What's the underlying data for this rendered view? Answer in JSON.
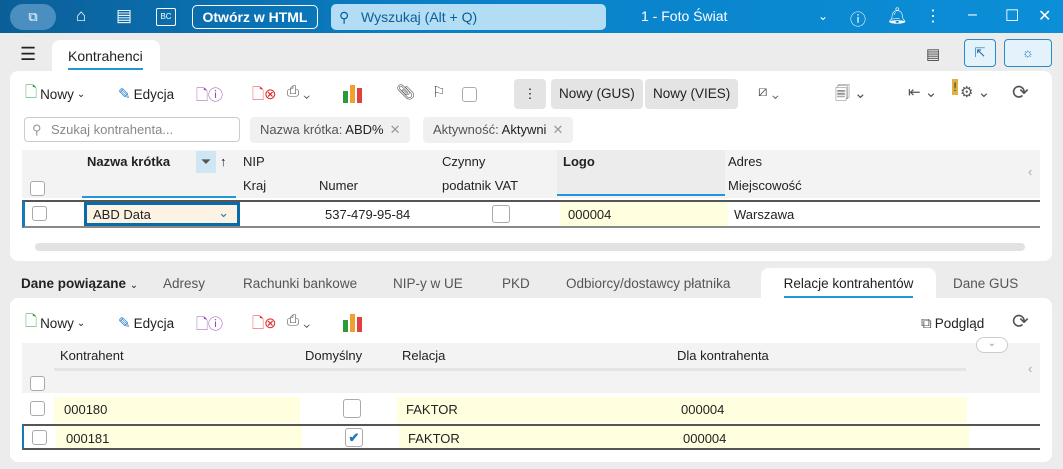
{
  "titlebar": {
    "open_html": "Otwórz w HTML",
    "search_placeholder": "Wyszukaj (Alt + Q)",
    "company": "1 - Foto Świat",
    "bc": "BC"
  },
  "tab": "Kontrahenci",
  "toolbar": {
    "new": "Nowy",
    "edit": "Edycja",
    "new_gus": "Nowy (GUS)",
    "new_vies": "Nowy (VIES)"
  },
  "filters": {
    "search_placeholder": "Szukaj kontrahenta...",
    "chip1_label": "Nazwa krótka:",
    "chip1_value": "ABD%",
    "chip2_label": "Aktywność:",
    "chip2_value": "Aktywni"
  },
  "grid": {
    "headers": {
      "name": "Nazwa krótka",
      "nip": "NIP",
      "country": "Kraj",
      "number": "Numer",
      "vat1": "Czynny",
      "vat2": "podatnik VAT",
      "logo": "Logo",
      "address": "Adres",
      "city": "Miejscowość"
    },
    "row": {
      "name": "ABD Data",
      "number": "537-479-95-84",
      "logo": "000004",
      "city": "Warszawa"
    }
  },
  "related": {
    "menu": "Dane powiązane",
    "tabs": [
      "Adresy",
      "Rachunki bankowe",
      "NIP-y w UE",
      "PKD",
      "Odbiorcy/dostawcy płatnika",
      "Relacje kontrahentów",
      "Dane GUS"
    ],
    "toolbar": {
      "new": "Nowy",
      "edit": "Edycja",
      "preview": "Podgląd"
    },
    "headers": {
      "contractor": "Kontrahent",
      "default": "Domyślny",
      "relation": "Relacja",
      "for": "Dla kontrahenta"
    },
    "rows": [
      {
        "contractor": "000180",
        "default": false,
        "relation": "FAKTOR",
        "for": "000004"
      },
      {
        "contractor": "000181",
        "default": true,
        "relation": "FAKTOR",
        "for": "000004"
      }
    ]
  }
}
